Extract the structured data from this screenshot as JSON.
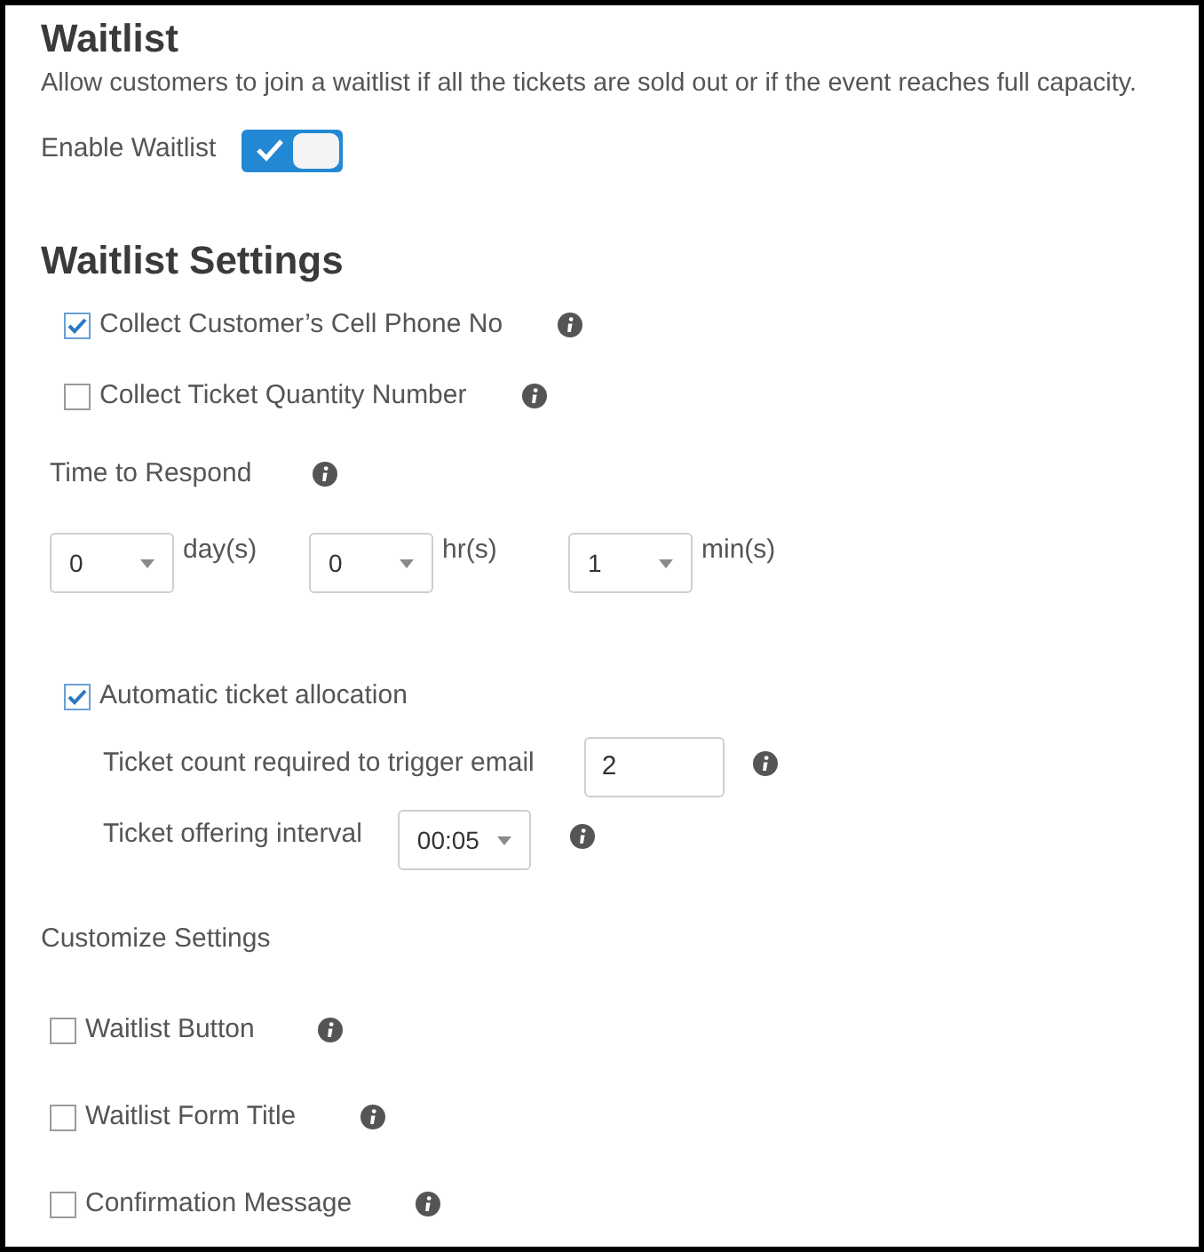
{
  "title": "Waitlist",
  "description": "Allow customers to join a waitlist if all the tickets are sold out or if the event reaches full capacity.",
  "enable_waitlist": {
    "label": "Enable Waitlist",
    "on": true
  },
  "waitlist_settings": {
    "heading": "Waitlist Settings",
    "options": [
      {
        "label": "Collect Customer’s Cell Phone No",
        "checked": true
      },
      {
        "label": "Collect Ticket Quantity Number",
        "checked": false
      }
    ]
  },
  "time_to_respond": {
    "label": "Time to Respond",
    "fields": [
      {
        "value": "0",
        "unit": "day(s)"
      },
      {
        "value": "0",
        "unit": "hr(s)"
      },
      {
        "value": "1",
        "unit": "min(s)"
      }
    ]
  },
  "automatic_allocation": {
    "label": "Automatic ticket allocation",
    "checked": true,
    "ticket_count": {
      "label": "Ticket count required to trigger email",
      "value": "2"
    },
    "offering_interval": {
      "label": "Ticket offering interval",
      "value": "00:05"
    }
  },
  "customize_settings": {
    "heading": "Customize Settings",
    "options": [
      {
        "label": "Waitlist Button",
        "checked": false
      },
      {
        "label": "Waitlist Form Title",
        "checked": false
      },
      {
        "label": "Confirmation Message",
        "checked": false
      }
    ]
  }
}
